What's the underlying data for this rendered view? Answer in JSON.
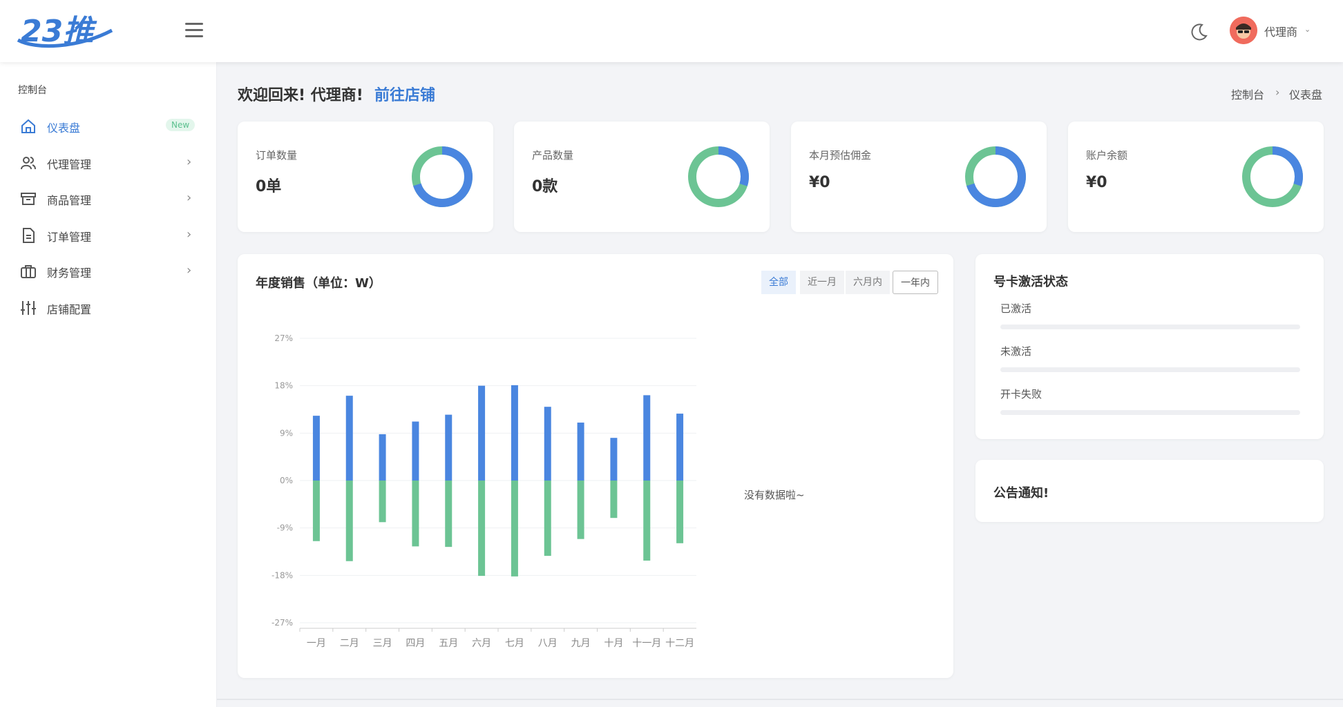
{
  "header": {
    "logo_text": "23推",
    "user_name": "代理商"
  },
  "sidebar": {
    "section_title": "控制台",
    "items": [
      {
        "label": "仪表盘",
        "badge": "New"
      },
      {
        "label": "代理管理"
      },
      {
        "label": "商品管理"
      },
      {
        "label": "订单管理"
      },
      {
        "label": "财务管理"
      },
      {
        "label": "店铺配置"
      }
    ]
  },
  "welcome": {
    "text": "欢迎回来! 代理商!",
    "link": "前往店铺"
  },
  "breadcrumb": {
    "root": "控制台",
    "separator": "›",
    "current": "仪表盘"
  },
  "stats": [
    {
      "title": "订单数量",
      "value": "0单",
      "donut_blue_fraction": 0.7
    },
    {
      "title": "产品数量",
      "value": "0款",
      "donut_blue_fraction": 0.3
    },
    {
      "title": "本月预估佣金",
      "value": "¥0",
      "donut_blue_fraction": 0.7
    },
    {
      "title": "账户余额",
      "value": "¥0",
      "donut_blue_fraction": 0.3
    }
  ],
  "sales_card": {
    "title": "年度销售（单位：W）",
    "filters": [
      "全部",
      "近一月",
      "六月内",
      "一年内"
    ],
    "no_data_text": "没有数据啦~"
  },
  "activation_card": {
    "title": "号卡激活状态",
    "rows": [
      "已激活",
      "未激活",
      "开卡失败"
    ]
  },
  "notice_card": {
    "title": "公告通知!"
  },
  "colors": {
    "blue": "#4a86e0",
    "green": "#6cc494",
    "accent": "#3a7bd5"
  },
  "chart_data": {
    "type": "bar",
    "categories": [
      "一月",
      "二月",
      "三月",
      "四月",
      "五月",
      "六月",
      "七月",
      "八月",
      "九月",
      "十月",
      "十一月",
      "十二月"
    ],
    "series": [
      {
        "values": [
          12.3,
          16.1,
          8.8,
          11.2,
          12.5,
          18.0,
          18.1,
          14.0,
          11.0,
          8.1,
          16.2,
          12.7
        ]
      },
      {
        "values": [
          -11.5,
          -15.3,
          -7.9,
          -12.5,
          -12.6,
          -18.1,
          -18.2,
          -14.3,
          -11.1,
          -7.1,
          -15.2,
          -11.9
        ]
      }
    ],
    "yticks": [
      "27%",
      "18%",
      "9%",
      "0%",
      "-9%",
      "-18%",
      "-27%"
    ],
    "ylim": [
      -27,
      27
    ],
    "grid": true
  }
}
